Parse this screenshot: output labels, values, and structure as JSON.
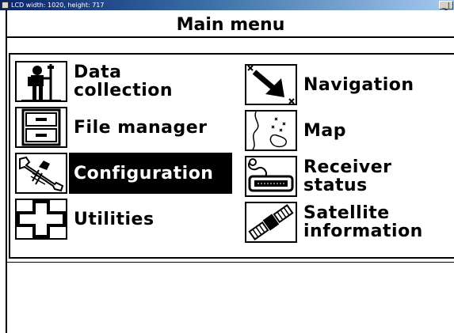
{
  "window": {
    "title": "LCD width: 1020, height: 717",
    "buttons": "_ | 8"
  },
  "screen_title": "Main menu",
  "menu": {
    "left": [
      {
        "label": "Data\ncollection",
        "icon": "surveyor-icon"
      },
      {
        "label": "File manager",
        "icon": "file-cabinet-icon"
      },
      {
        "label": "Configuration",
        "icon": "wrench-icon",
        "selected": true
      },
      {
        "label": "Utilities",
        "icon": "cross-icon"
      }
    ],
    "right": [
      {
        "label": "Navigation",
        "icon": "navigation-arrow-icon"
      },
      {
        "label": "Map",
        "icon": "map-icon"
      },
      {
        "label": "Receiver\nstatus",
        "icon": "receiver-icon"
      },
      {
        "label": "Satellite\ninformation",
        "icon": "satellite-icon"
      }
    ]
  }
}
